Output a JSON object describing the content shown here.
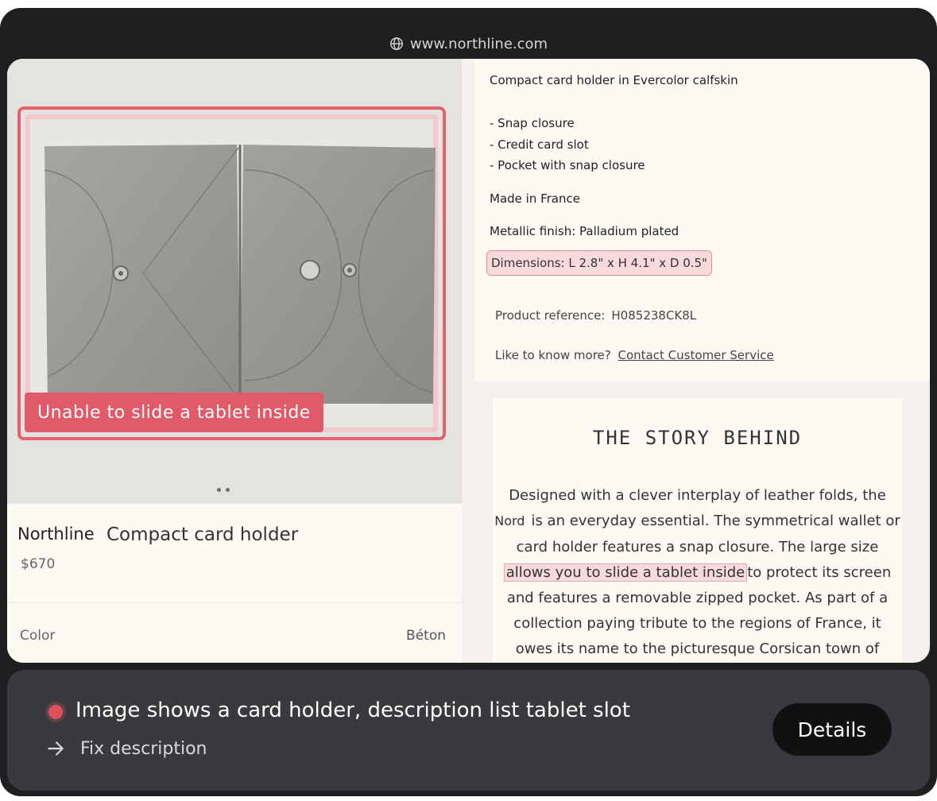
{
  "browser": {
    "url": "www.northline.com"
  },
  "product": {
    "image_warning": "Unable to slide a tablet inside",
    "brand": "Northline",
    "name": "Compact card holder",
    "price": "$670",
    "color_label": "Color",
    "color_value": "Béton"
  },
  "details": {
    "headline": "Compact card holder in Evercolor calfskin",
    "bullets": [
      "- Snap closure",
      "- Credit card slot",
      "- Pocket with snap closure"
    ],
    "origin": "Made in France",
    "finish": "Metallic finish: Palladium plated",
    "dimensions": "Dimensions: L 2.8\" x H 4.1\" x D 0.5\"",
    "ref_label": "Product reference:",
    "ref_value": "H085238CK8L",
    "know_more": "Like to know more?",
    "contact_link": "Contact Customer Service"
  },
  "story": {
    "title": "THE STORY BEHIND",
    "line1": "Designed with a clever interplay of leather folds, the",
    "line2_a": "Nord",
    "line2_b": "is an everyday essential. The symmetrical wallet or",
    "line3": "card holder features a snap closure. The large size",
    "line4_hl": "allows you to slide a tablet inside",
    "line4_b": "to protect its screen",
    "line5": "and features a removable zipped pocket. As part of a",
    "line6": "collection paying tribute to the regions of France, it",
    "line7": "owes its name to the picturesque Corsican town of"
  },
  "alert": {
    "message": "Image shows a card holder, description list tablet slot",
    "fix_label": "Fix description",
    "details_label": "Details"
  }
}
